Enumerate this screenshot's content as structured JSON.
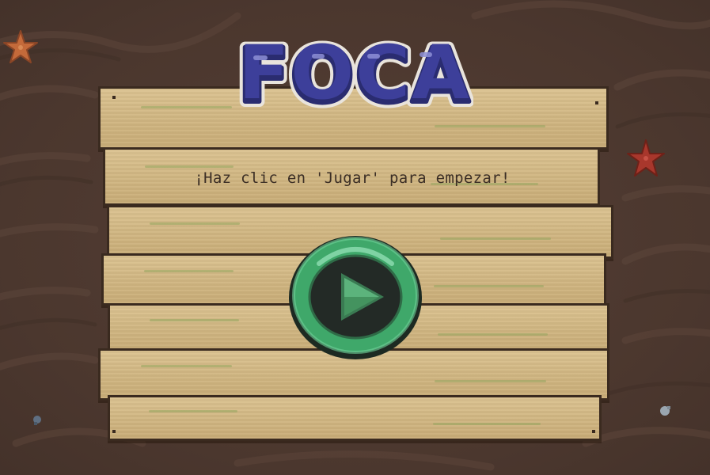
{
  "game": {
    "title": "FOCA",
    "instruction": "¡Haz clic en 'Jugar' para empezar!"
  },
  "play_button": {
    "icon": "play-icon",
    "color": "#3fa86a"
  },
  "decorations": {
    "starfish": [
      "starfish-orange",
      "starfish-red"
    ],
    "pebbles": [
      "pebble-left",
      "pebble-right"
    ]
  },
  "colors": {
    "background": "#4e3a31",
    "wood": "#d2b884",
    "title_fill": "#3d3f9a",
    "title_outline": "#e9e4dc",
    "button_green": "#3fa86a"
  }
}
